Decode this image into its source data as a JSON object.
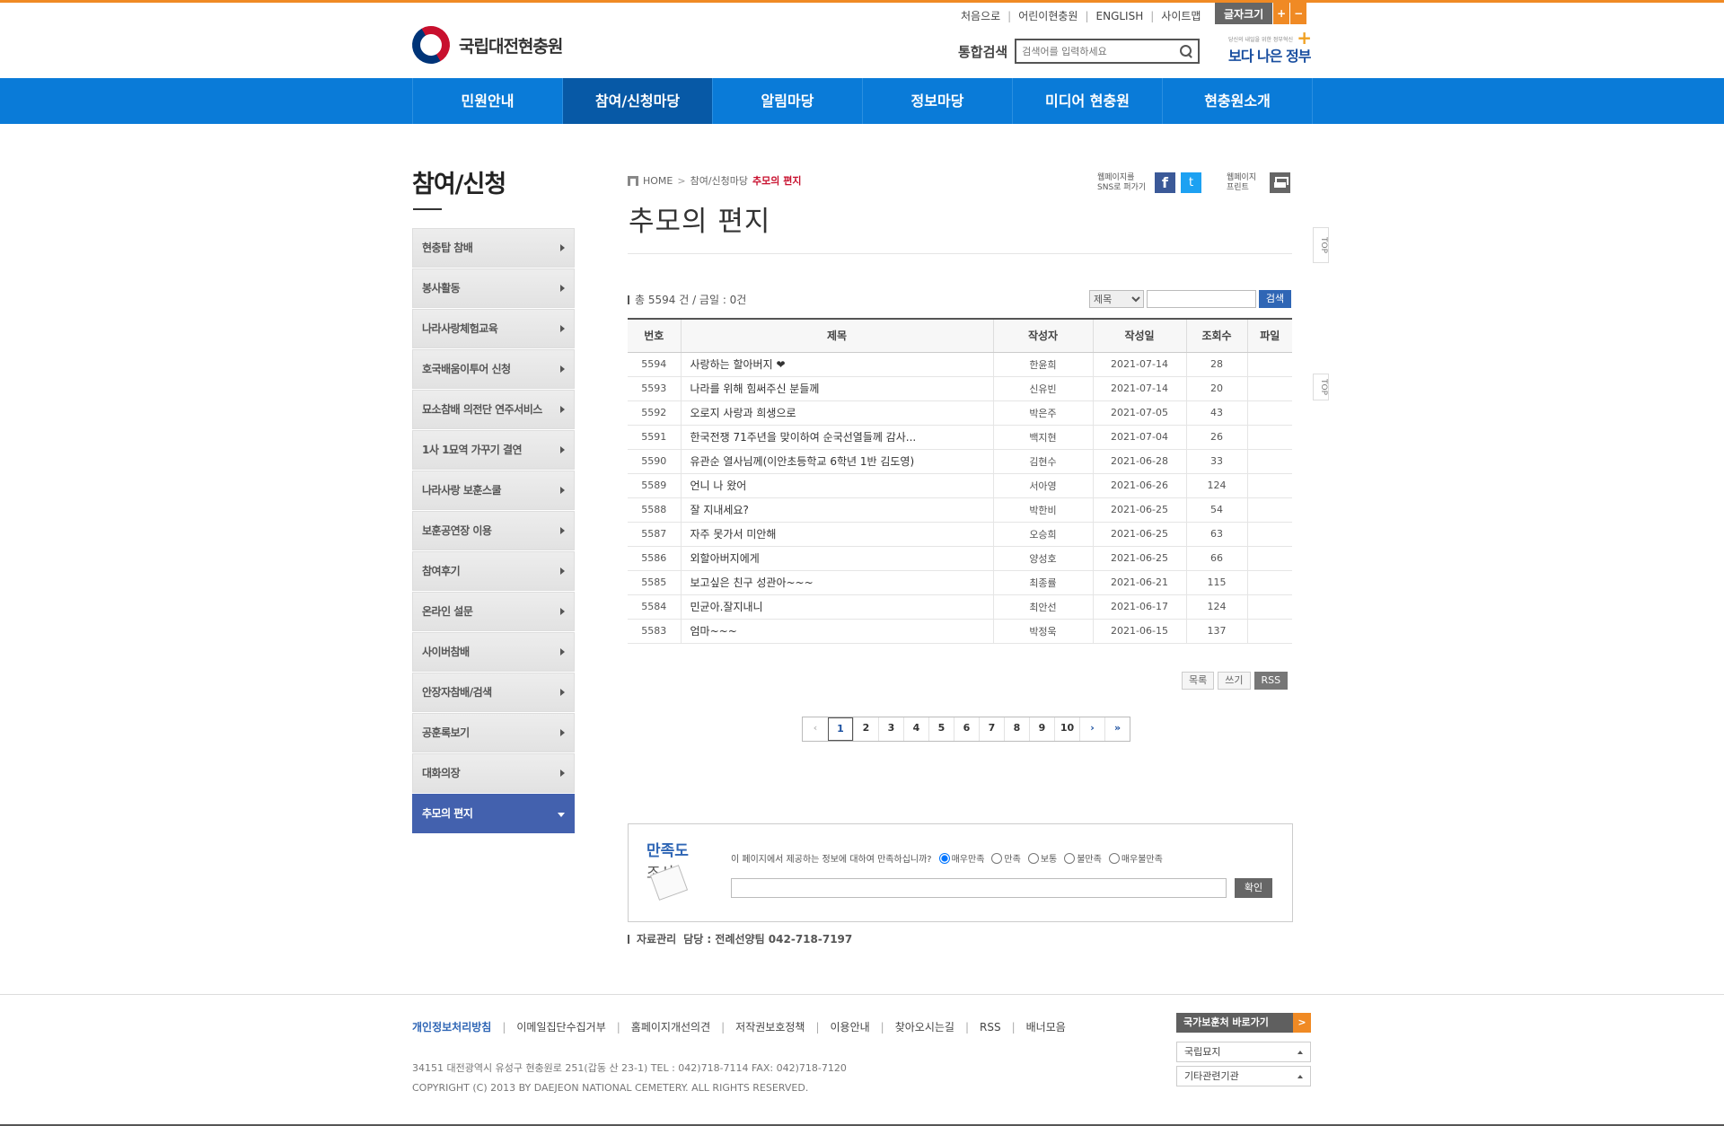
{
  "header": {
    "logo_text": "국립대전현충원",
    "util_links": [
      "처음으로",
      "어린이현충원",
      "ENGLISH",
      "사이트맵"
    ],
    "font_size_label": "글자크기",
    "font_plus": "+",
    "font_minus": "−",
    "search_label": "통합검색",
    "search_placeholder": "검색어를 입력하세요",
    "gov_small": "당신의 내일을 위한 정부혁신",
    "gov_big": "보다 나은 정부"
  },
  "gnb": [
    "민원안내",
    "참여/신청마당",
    "알림마당",
    "정보마당",
    "미디어 현충원",
    "현충원소개"
  ],
  "sidebar": {
    "title": "참여/신청",
    "items": [
      "현충탑 참배",
      "봉사활동",
      "나라사랑체험교육",
      "호국배움이투어 신청",
      "묘소참배 의전단 연주서비스",
      "1사 1묘역 가꾸기 결연",
      "나라사랑 보훈스쿨",
      "보훈공연장 이용",
      "참여후기",
      "온라인 설문",
      "사이버참배",
      "안장자참배/검색",
      "공훈록보기",
      "대화의장",
      "추모의 편지"
    ]
  },
  "breadcrumb": {
    "home": "HOME",
    "parent": "참여/신청마당",
    "current": "추모의 편지",
    "sep": ">"
  },
  "sns": {
    "label": "웹페이지를 SNS로 퍼가기",
    "print_label": "웹페이지 프린트",
    "fb": "f",
    "tw": "t"
  },
  "page_title": "추모의 편지",
  "side_top": "TOP",
  "board": {
    "count_text": "총 5594 건 / 금일 : 0건",
    "search_select": "제목",
    "search_button": "검색",
    "headers": [
      "번호",
      "제목",
      "작성자",
      "작성일",
      "조회수",
      "파일"
    ],
    "rows": [
      {
        "no": "5594",
        "title": "사랑하는 할아버지 ❤",
        "author": "한윤희",
        "date": "2021-07-14",
        "views": "28"
      },
      {
        "no": "5593",
        "title": "나라를 위해 힘써주신 분들께",
        "author": "신유빈",
        "date": "2021-07-14",
        "views": "20"
      },
      {
        "no": "5592",
        "title": "오로지 사랑과 희생으로",
        "author": "박은주",
        "date": "2021-07-05",
        "views": "43"
      },
      {
        "no": "5591",
        "title": "한국전쟁 71주년을 맞이하여 순국선열들께 감사...",
        "author": "백지현",
        "date": "2021-07-04",
        "views": "26"
      },
      {
        "no": "5590",
        "title": "유관순 열사님께(이안초등학교 6학년 1반 김도영)",
        "author": "김현수",
        "date": "2021-06-28",
        "views": "33"
      },
      {
        "no": "5589",
        "title": "언니 나 왔어",
        "author": "서아영",
        "date": "2021-06-26",
        "views": "124"
      },
      {
        "no": "5588",
        "title": "잘 지내세요?",
        "author": "박한비",
        "date": "2021-06-25",
        "views": "54"
      },
      {
        "no": "5587",
        "title": "자주 못가서 미안해",
        "author": "오승희",
        "date": "2021-06-25",
        "views": "63"
      },
      {
        "no": "5586",
        "title": "외할아버지에게",
        "author": "양성호",
        "date": "2021-06-25",
        "views": "66"
      },
      {
        "no": "5585",
        "title": "보고싶은 친구 성관아~~~",
        "author": "최종률",
        "date": "2021-06-21",
        "views": "115"
      },
      {
        "no": "5584",
        "title": "민균아.잘지내니",
        "author": "최안선",
        "date": "2021-06-17",
        "views": "124"
      },
      {
        "no": "5583",
        "title": "엄마~~~",
        "author": "박정욱",
        "date": "2021-06-15",
        "views": "137"
      }
    ],
    "buttons": [
      "목록",
      "쓰기",
      "RSS"
    ]
  },
  "paging": {
    "prev": "‹",
    "pages": [
      "1",
      "2",
      "3",
      "4",
      "5",
      "6",
      "7",
      "8",
      "9",
      "10"
    ],
    "next": "›",
    "last": "»",
    "current": "1"
  },
  "survey": {
    "title1": "만족도",
    "title2": "조사",
    "question": "이 페이지에서 제공하는 정보에 대하여 만족하십니까?",
    "options": [
      "매우만족",
      "만족",
      "보통",
      "불만족",
      "매우불만족"
    ],
    "selected": "매우만족",
    "confirm": "확인"
  },
  "manager": {
    "label": "자료관리",
    "contact": "담당 : 전례선양팀 042-718-7197"
  },
  "footer": {
    "links": [
      "개인정보처리방침",
      "이메일집단수집거부",
      "홈페이지개선의견",
      "저작권보호정책",
      "이용안내",
      "찾아오시는길",
      "RSS",
      "배너모음"
    ],
    "address": "34151 대전광역시 유성구 현충원로 251(갑동 산 23-1) TEL : 042)718-7114 FAX: 042)718-7120",
    "copyright": "COPYRIGHT (C) 2013 BY DAEJEON NATIONAL CEMETERY. ALL RIGHTS RESERVED.",
    "quick_button": "국가보훈처 바로가기",
    "quick_go": ">",
    "select1": "국립묘지",
    "select2": "기타관련기관"
  },
  "colors": {
    "accent_orange": "#f08a24",
    "gnb_blue": "#0a7bd8",
    "gnb_active": "#0759a6",
    "lnb_active": "#4361ae"
  }
}
